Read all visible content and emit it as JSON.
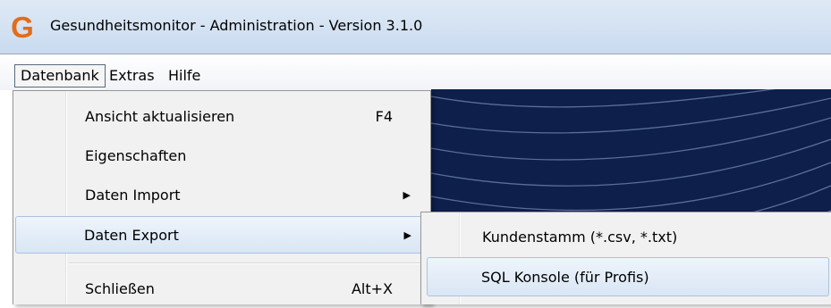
{
  "window": {
    "app_icon_letter": "G",
    "title": "Gesundheitsmonitor - Administration - Version 3.1.0"
  },
  "menubar": {
    "items": [
      {
        "label": "Datenbank",
        "open": true
      },
      {
        "label": "Extras"
      },
      {
        "label": "Hilfe"
      }
    ]
  },
  "datenbank_menu": {
    "items": [
      {
        "label": "Ansicht aktualisieren",
        "shortcut": "F4"
      },
      {
        "label": "Eigenschaften"
      },
      {
        "label": "Daten Import",
        "submenu": true
      },
      {
        "label": "Daten Export",
        "submenu": true,
        "highlighted": true
      },
      {
        "label": "Schließen",
        "shortcut": "Alt+X"
      }
    ],
    "submenu_arrow": "▶"
  },
  "export_submenu": {
    "items": [
      {
        "label": "Kundenstamm (*.csv, *.txt)"
      },
      {
        "label": "SQL Konsole (für Profis)",
        "highlighted": true
      }
    ]
  },
  "colors": {
    "titlebar": "#d2e1f2",
    "app_icon": "#e46b18",
    "background_area": "#0d1f4a",
    "highlight_border": "#a9c3e2"
  }
}
